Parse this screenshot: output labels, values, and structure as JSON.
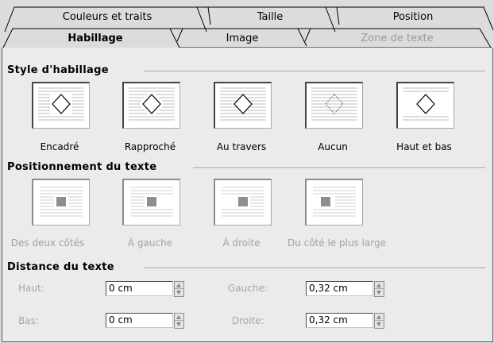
{
  "tabs_back": [
    "Couleurs et traits",
    "Taille",
    "Position"
  ],
  "tabs_front": [
    {
      "label": "Habillage",
      "state": "active"
    },
    {
      "label": "Image",
      "state": "normal"
    },
    {
      "label": "Zone de texte",
      "state": "disabled"
    }
  ],
  "wrap_style": {
    "title": "Style d'habillage",
    "options": [
      {
        "label": "Encadré",
        "icon": "wrap-square-icon"
      },
      {
        "label": "Rapproché",
        "icon": "wrap-tight-icon"
      },
      {
        "label": "Au travers",
        "icon": "wrap-through-icon"
      },
      {
        "label": "Aucun",
        "icon": "wrap-none-icon"
      },
      {
        "label": "Haut et bas",
        "icon": "wrap-top-bottom-icon"
      }
    ]
  },
  "text_position": {
    "title": "Positionnement du texte",
    "options": [
      {
        "label": "Des deux côtés"
      },
      {
        "label": "À gauche"
      },
      {
        "label": "À droite"
      },
      {
        "label": "Du côté le plus large"
      }
    ]
  },
  "text_distance": {
    "title": "Distance du texte",
    "top": {
      "label": "Haut:",
      "value": "0 cm"
    },
    "bottom": {
      "label": "Bas:",
      "value": "0 cm"
    },
    "left": {
      "label": "Gauche:",
      "value": "0,32 cm"
    },
    "right": {
      "label": "Droite:",
      "value": "0,32 cm"
    }
  }
}
